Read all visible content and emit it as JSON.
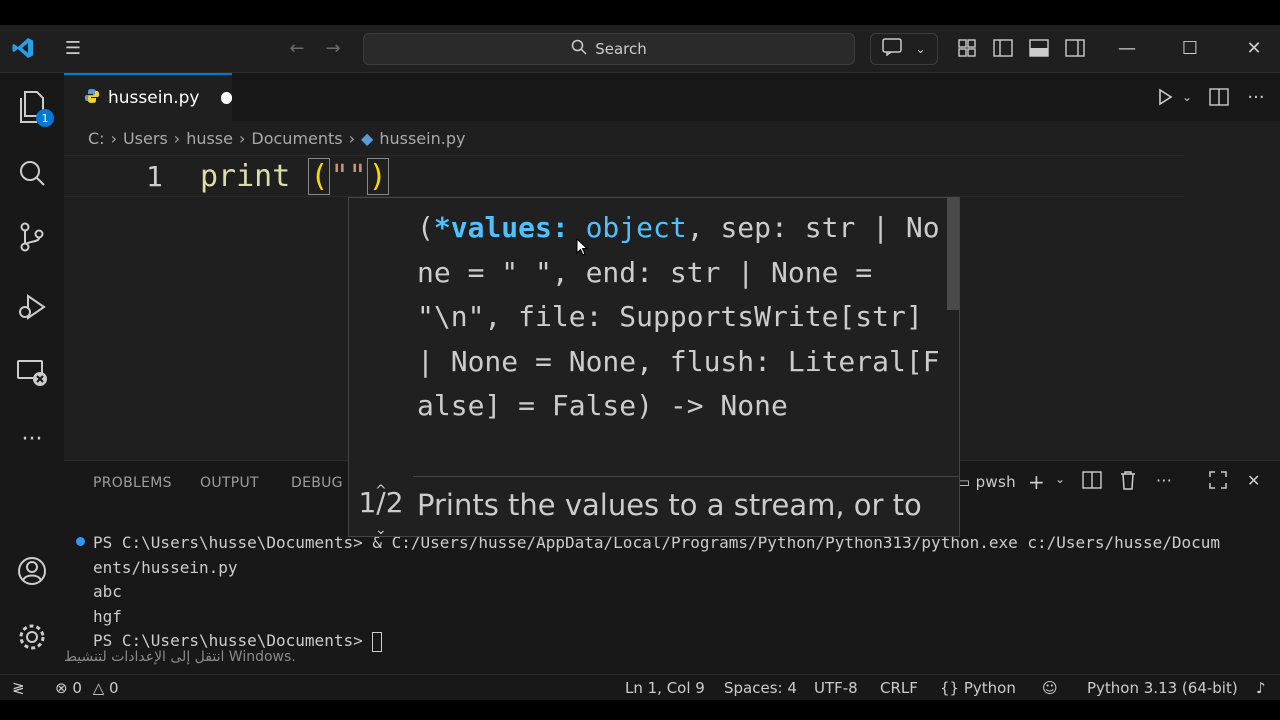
{
  "titlebar": {
    "search_label": "Search"
  },
  "activity": {
    "explorer_badge": "1"
  },
  "tab": {
    "filename": "hussein.py"
  },
  "breadcrumb": [
    "C:",
    "Users",
    "husse",
    "Documents",
    "hussein.py"
  ],
  "editor": {
    "line_number": "1",
    "code_fn": "print ",
    "code_open": "(",
    "code_str": "\"\"",
    "code_close": ")"
  },
  "hover": {
    "sig_open": "(",
    "sig_values": "*values:",
    "sig_object": " object",
    "sig_rest": ", sep: str | None = \" \", end: str | None = \"\\n\", file: SupportsWrite[str] | None = None, flush: Literal[False] = False) -> None",
    "counter": "1/2",
    "doc": "Prints the values to a stream, or to"
  },
  "panel": {
    "tabs": [
      "PROBLEMS",
      "OUTPUT",
      "DEBUG C"
    ],
    "shell": "pwsh",
    "terminal": [
      "PS C:\\Users\\husse\\Documents> & C:/Users/husse/AppData/Local/Programs/Python/Python313/python.exe c:/Users/husse/Docum",
      "ents/hussein.py",
      "abc",
      "hgf",
      "PS C:\\Users\\husse\\Documents> "
    ],
    "watermark": "انتقل إلى الإعدادات لتنشيط Windows."
  },
  "status": {
    "errors": "0",
    "warnings": "0",
    "position": "Ln 1, Col 9",
    "spaces": "Spaces: 4",
    "encoding": "UTF-8",
    "eol": "CRLF",
    "language": "Python",
    "interpreter": "Python 3.13 (64-bit)"
  },
  "colors": {
    "accent": "#0078d4",
    "function": "#dcdcaa",
    "string": "#ce9178",
    "param": "#4fc1ff"
  }
}
